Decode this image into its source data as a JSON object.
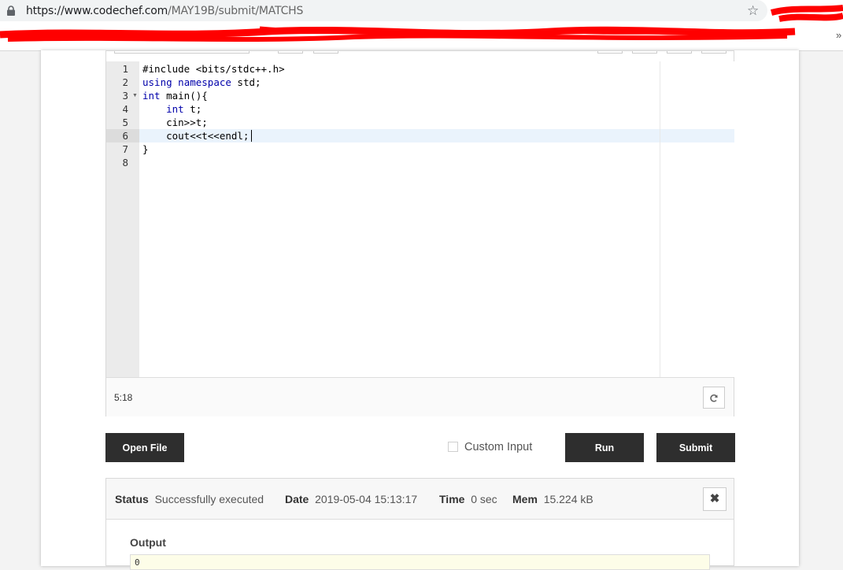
{
  "browser": {
    "url_host": "https://www.codechef.com",
    "url_path": "/MAY19B/submit/MATCHS",
    "icons": {
      "lock": "lock-icon",
      "star": "star-icon",
      "overflow": "double-chevron-icon"
    },
    "overflow_glyph": "»"
  },
  "editor": {
    "line_numbers": [
      "1",
      "2",
      "3",
      "4",
      "5",
      "6",
      "7",
      "8"
    ],
    "lines": [
      "#include <bits/stdc++.h>",
      "using namespace std;",
      "int main(){",
      "    int t;",
      "    cin>>t;",
      "    cout<<t<<endl;",
      "}",
      ""
    ],
    "active_line": 6,
    "cursor_position": "5:18",
    "icons": {
      "refresh": "refresh-icon",
      "fold": "fold-arrow-icon"
    }
  },
  "actions": {
    "open_file_label": "Open File",
    "custom_input_label": "Custom Input",
    "run_label": "Run",
    "submit_label": "Submit"
  },
  "result": {
    "status_label": "Status",
    "status_value": "Successfully executed",
    "date_label": "Date",
    "date_value": "2019-05-04 15:13:17",
    "time_label": "Time",
    "time_value": "0 sec",
    "mem_label": "Mem",
    "mem_value": "15.224 kB",
    "output_label": "Output",
    "output_value": "0",
    "icons": {
      "close": "close-icon"
    }
  },
  "colors": {
    "button_dark": "#2e2e2e",
    "keyword": "#0000aa",
    "redaction": "#ff0000",
    "output_bg": "#fdfde8"
  }
}
